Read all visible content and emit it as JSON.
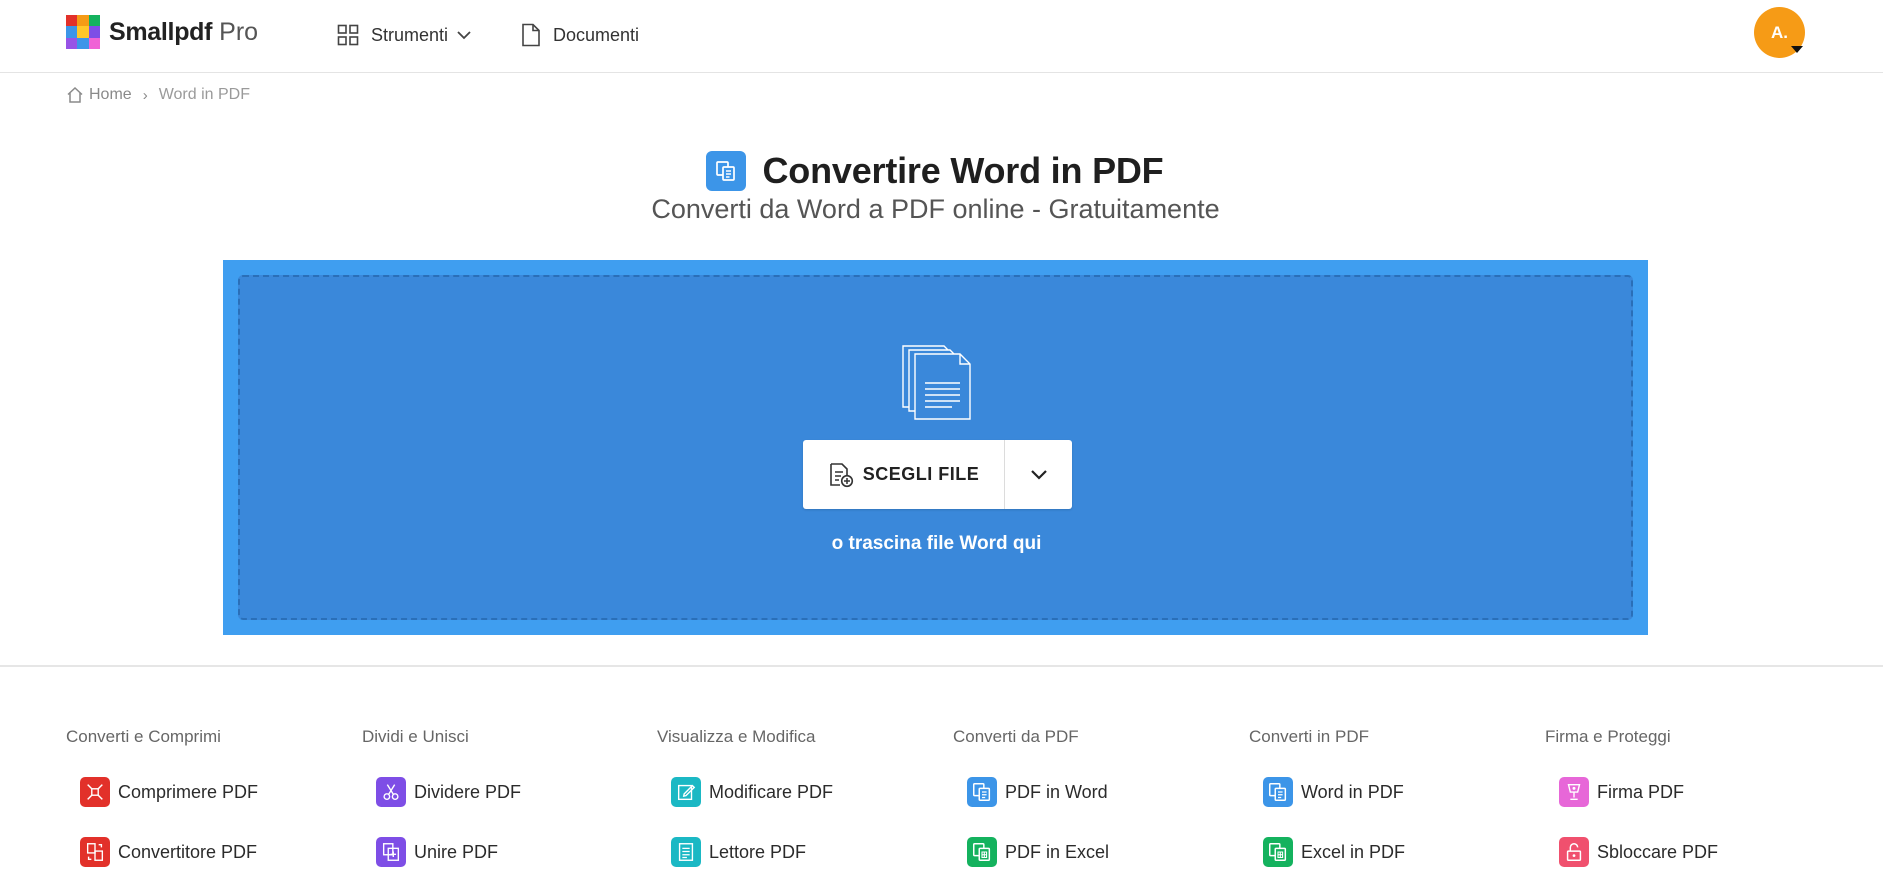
{
  "header": {
    "brand": "Smallpdf",
    "brand_suffix": "Pro",
    "logo_colors": [
      "#e2312a",
      "#f59b16",
      "#14b25e",
      "#3c95e8",
      "#ffc729",
      "#7e4ee6",
      "#9753e6",
      "#3c95e8",
      "#f062d6"
    ],
    "nav": {
      "tools": "Strumenti",
      "documents": "Documenti"
    },
    "avatar_initials": "A.",
    "avatar_color": "#f69b16"
  },
  "breadcrumb": {
    "home": "Home",
    "separator": "›",
    "current": "Word in PDF"
  },
  "page": {
    "title": "Convertire Word in PDF",
    "subtitle": "Converti da Word a PDF online - Gratuitamente",
    "accent": "#3c95e8"
  },
  "dropzone": {
    "choose_label": "SCEGLI FILE",
    "drag_hint": "o trascina file Word qui",
    "outer_color": "#3f9ef0",
    "inner_color": "#3a88da"
  },
  "footer": {
    "columns": [
      {
        "title": "Converti e Comprimi",
        "items": [
          {
            "label": "Comprimere PDF",
            "icon": "compress-icon",
            "color": "#e2312a"
          },
          {
            "label": "Convertitore PDF",
            "icon": "convert-icon",
            "color": "#e2312a"
          }
        ]
      },
      {
        "title": "Dividi e Unisci",
        "items": [
          {
            "label": "Dividere PDF",
            "icon": "scissors-icon",
            "color": "#7e4ee6"
          },
          {
            "label": "Unire PDF",
            "icon": "merge-icon",
            "color": "#7e4ee6"
          }
        ]
      },
      {
        "title": "Visualizza e Modifica",
        "items": [
          {
            "label": "Modificare PDF",
            "icon": "edit-icon",
            "color": "#1bb8c4"
          },
          {
            "label": "Lettore PDF",
            "icon": "reader-icon",
            "color": "#1bb8c4"
          }
        ]
      },
      {
        "title": "Converti da PDF",
        "items": [
          {
            "label": "PDF in Word",
            "icon": "word-icon",
            "color": "#3c95e8"
          },
          {
            "label": "PDF in Excel",
            "icon": "excel-icon",
            "color": "#14b25e"
          }
        ]
      },
      {
        "title": "Converti in PDF",
        "items": [
          {
            "label": "Word in PDF",
            "icon": "word-icon",
            "color": "#3c95e8"
          },
          {
            "label": "Excel in PDF",
            "icon": "excel-icon",
            "color": "#14b25e"
          }
        ]
      },
      {
        "title": "Firma e Proteggi",
        "items": [
          {
            "label": "Firma PDF",
            "icon": "sign-icon",
            "color": "#e767d8"
          },
          {
            "label": "Sbloccare PDF",
            "icon": "unlock-icon",
            "color": "#f0506e"
          }
        ]
      }
    ]
  }
}
